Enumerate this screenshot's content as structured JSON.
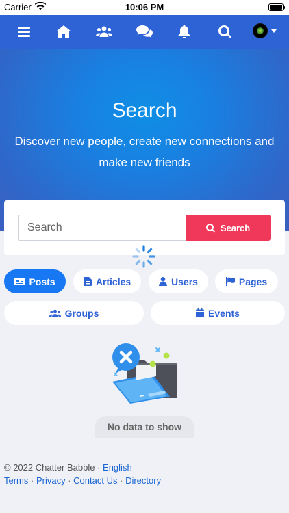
{
  "status_bar": {
    "carrier": "Carrier",
    "time": "10:06 PM"
  },
  "navbar": {
    "icons": [
      "menu-icon",
      "home-icon",
      "people-icon",
      "chat-icon",
      "bell-icon",
      "search-icon",
      "avatar"
    ]
  },
  "hero": {
    "title": "Search",
    "subtitle": "Discover new people, create new connections and make new friends"
  },
  "search": {
    "placeholder": "Search",
    "value": "",
    "button_label": "Search"
  },
  "filters": {
    "posts": "Posts",
    "articles": "Articles",
    "users": "Users",
    "pages": "Pages",
    "groups": "Groups",
    "events": "Events",
    "active": "posts"
  },
  "empty_state": {
    "message": "No data to show"
  },
  "footer": {
    "copyright": "© 2022 Chatter Babble",
    "language": "English",
    "links": {
      "terms": "Terms",
      "privacy": "Privacy",
      "contact": "Contact Us",
      "directory": "Directory"
    }
  },
  "colors": {
    "primary": "#2e63d6",
    "active_chip": "#1877f2",
    "search_button": "#f0385a",
    "background": "#eff1f6"
  }
}
